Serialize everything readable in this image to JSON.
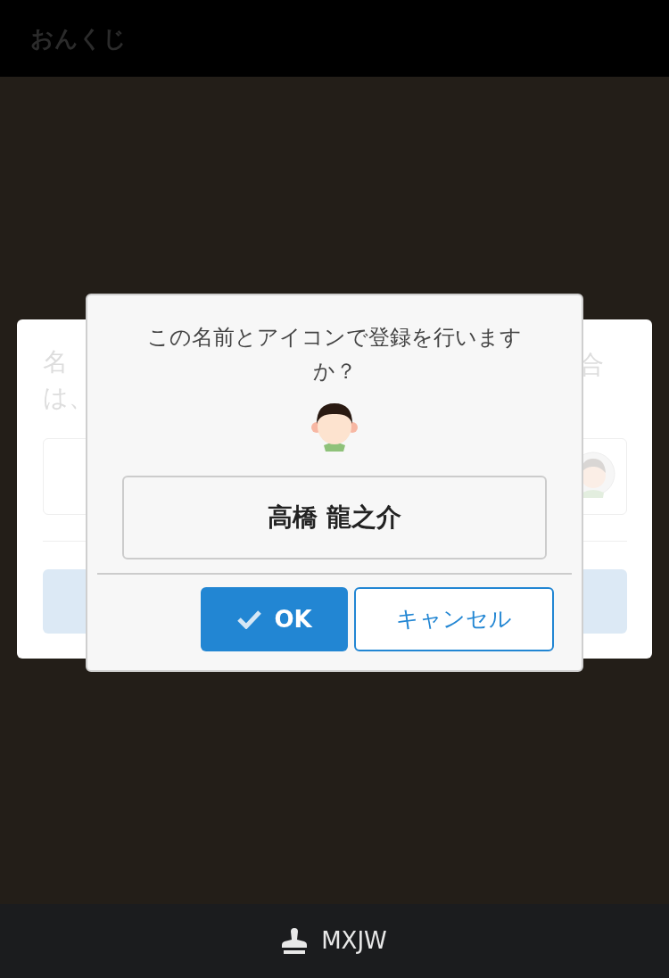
{
  "header": {
    "title": "おんくじ"
  },
  "background_card": {
    "left_text": [
      "名",
      "は、"
    ],
    "right_text": "合"
  },
  "dialog": {
    "message": "この名前とアイコンで登録を行いますか？",
    "name": "高橋 龍之介",
    "buttons": [
      {
        "label": "OK",
        "kind": "primary"
      },
      {
        "label": "キャンセル",
        "kind": "secondary"
      }
    ]
  },
  "footer": {
    "label": "MXJW"
  }
}
